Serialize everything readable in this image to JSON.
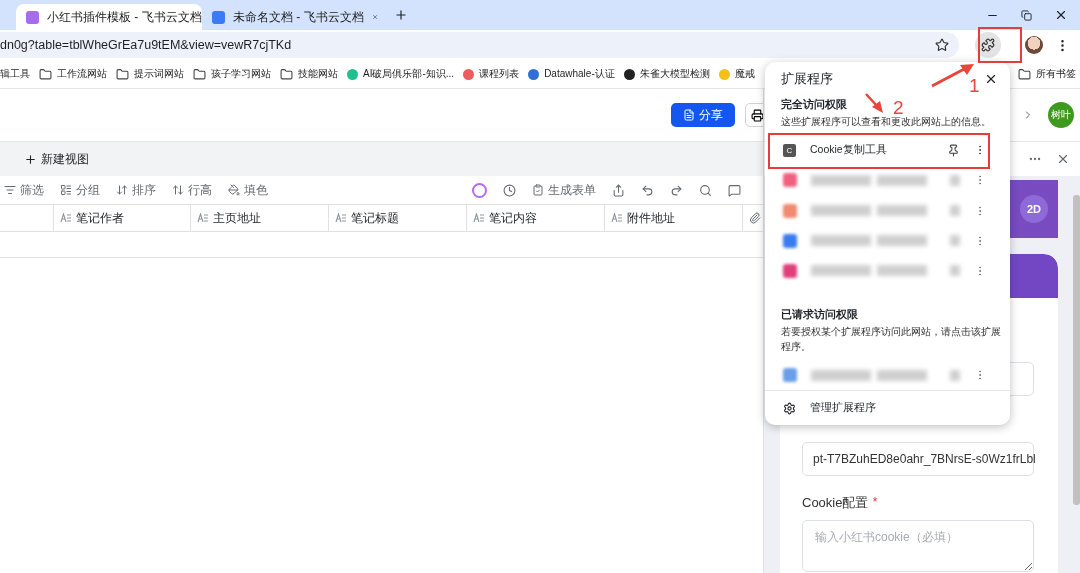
{
  "browser": {
    "tabs": [
      {
        "title": "小红书插件模板 - 飞书云文档",
        "selected": true,
        "color": "#a66cf0"
      },
      {
        "title": "未命名文档 - 飞书云文档",
        "selected": false,
        "color": "#3b7cf6"
      }
    ],
    "url": "dn0g?table=tblWheGrEa7u9tEM&view=vewR7cjTKd",
    "bookmarks": [
      {
        "label": "辑工具",
        "kind": "plain"
      },
      {
        "label": "工作流网站",
        "kind": "folder"
      },
      {
        "label": "提示词网站",
        "kind": "folder"
      },
      {
        "label": "孩子学习网站",
        "kind": "folder"
      },
      {
        "label": "技能网站",
        "kind": "folder"
      },
      {
        "label": "AI破局俱乐部-知识...",
        "kind": "site",
        "color": "#1fbf8f"
      },
      {
        "label": "课程列表",
        "kind": "site",
        "color": "#f05a5a"
      },
      {
        "label": "Datawhale-认证",
        "kind": "site",
        "color": "#2f6fd6"
      },
      {
        "label": "朱雀大模型检测",
        "kind": "site",
        "color": "#222222"
      },
      {
        "label": "魔戒",
        "kind": "site",
        "color": "#f2c018"
      }
    ],
    "all_bookmarks": "所有书签"
  },
  "app": {
    "share_button": "分享",
    "new_view": "新建视图",
    "toolbar": [
      "筛选",
      "分组",
      "排序",
      "行高",
      "填色"
    ],
    "generate_form": "生成表单",
    "columns": [
      "笔记作者",
      "主页地址",
      "笔记标题",
      "笔记内容",
      "附件地址"
    ],
    "avatar": "树叶"
  },
  "side_panel": {
    "badge": "2D",
    "token_value": "pt-T7BZuhED8e0ahr_7BNrsE-s0Wz1frLbl",
    "cookie_label": "Cookie配置",
    "required_mark": "*",
    "cookie_placeholder": "输入小红书cookie（必填）"
  },
  "extensions_popup": {
    "title": "扩展程序",
    "full_access": {
      "heading": "完全访问权限",
      "description": "这些扩展程序可以查看和更改此网站上的信息。",
      "items": [
        {
          "kind": "named",
          "icon_letter": "C",
          "name": "Cookie复制工具"
        },
        {
          "kind": "blurred",
          "color": "#f06080"
        },
        {
          "kind": "blurred",
          "color": "#f08a70"
        },
        {
          "kind": "blurred",
          "color": "#3a7cf0"
        },
        {
          "kind": "blurred",
          "color": "#e0407a"
        }
      ]
    },
    "requested_access": {
      "heading": "已请求访问权限",
      "description": "若要授权某个扩展程序访问此网站，请点击该扩展程序。",
      "items": [
        {
          "kind": "blurred",
          "color": "#6a9ee8"
        }
      ]
    },
    "manage": "管理扩展程序"
  },
  "annotations": [
    {
      "label": "1"
    },
    {
      "label": "2"
    }
  ]
}
